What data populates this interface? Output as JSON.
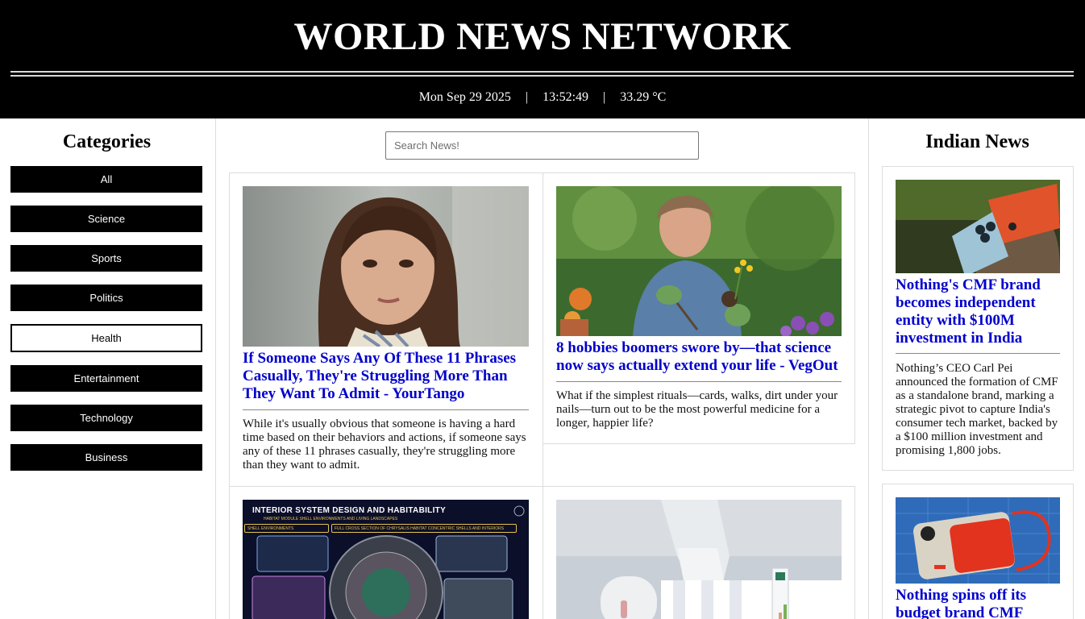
{
  "header": {
    "site_title": "WORLD NEWS NETWORK",
    "date": "Mon Sep 29 2025",
    "separator": "|",
    "time": "13:52:49",
    "temperature": "33.29 °C"
  },
  "categories": {
    "title": "Categories",
    "items": [
      {
        "label": "All"
      },
      {
        "label": "Science"
      },
      {
        "label": "Sports"
      },
      {
        "label": "Politics"
      },
      {
        "label": "Health"
      },
      {
        "label": "Entertainment"
      },
      {
        "label": "Technology"
      },
      {
        "label": "Business"
      }
    ],
    "active": "Health"
  },
  "search": {
    "placeholder": "Search News!"
  },
  "articles": [
    {
      "title": "If Someone Says Any Of These 11 Phrases Casually, They're Struggling More Than They Want To Admit - YourTango",
      "description": "While it's usually obvious that someone is having a hard time based on their behaviors and actions, if someone says any of these 11 phrases casually, they're struggling more than they want to admit."
    },
    {
      "title": "8 hobbies boomers swore by—that science now says actually extend your life - VegOut",
      "description": "What if the simplest rituals—cards, walks, dirt under your nails—turn out to be the most powerful medicine for a longer, happier life?"
    },
    {
      "image_text": {
        "heading": "INTERIOR SYSTEM DESIGN AND HABITABILITY",
        "subheading": "HABITAT MODULE SHELL ENVIRONMENTS AND LIVING LANDSCAPES",
        "tag1": "SHELL ENVIRONMENTS",
        "tag2": "FULL CROSS SECTION OF CHRYSALIS HABITAT CONCENTRIC SHELLS AND INTERIORS"
      }
    },
    {}
  ],
  "indian_news": {
    "title": "Indian News",
    "items": [
      {
        "title": "Nothing's CMF brand becomes independent entity with $100M investment in India",
        "description": "Nothing’s CEO Carl Pei announced the formation of CMF as a standalone brand, marking a strategic pivot to capture India's consumer tech market, backed by a $100 million investment and promising 1,800 jobs."
      },
      {
        "title": "Nothing spins off its budget brand CMF"
      }
    ]
  },
  "colors": {
    "header_bg": "#000000",
    "link_blue": "#0000cc",
    "button_bg": "#000000"
  }
}
